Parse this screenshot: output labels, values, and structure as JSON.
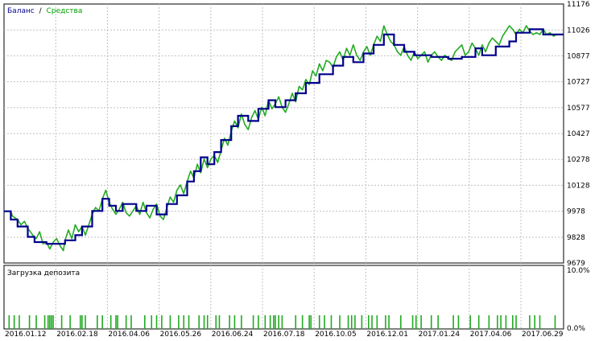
{
  "legend": {
    "balance_label": "Баланс",
    "separator": "/",
    "equity_label": "Средства",
    "balance_color": "#00008b",
    "equity_color": "#22aa22"
  },
  "deposit_panel": {
    "label": "Загрузка депозита",
    "y_ticks": [
      "10.0%",
      "0.0%"
    ],
    "bar_color": "#22aa22"
  },
  "chart_data": {
    "type": "line",
    "x_ticks": [
      "2016.01.12",
      "2016.02.18",
      "2016.04.06",
      "2016.05.26",
      "2016.06.24",
      "2016.07.18",
      "2016.10.05",
      "2016.12.01",
      "2017.01.24",
      "2017.04.06",
      "2017.06.29"
    ],
    "y_ticks": [
      11176,
      11026,
      10877,
      10727,
      10577,
      10427,
      10278,
      10128,
      9978,
      9828,
      9679
    ],
    "ylim": [
      9679,
      11176
    ],
    "xlim": [
      0,
      330
    ],
    "series": [
      {
        "name": "Баланс",
        "x": [
          0,
          4,
          4,
          8,
          8,
          14,
          14,
          18,
          18,
          25,
          25,
          36,
          36,
          42,
          42,
          46,
          46,
          52,
          52,
          58,
          58,
          62,
          62,
          66,
          66,
          70,
          70,
          78,
          78,
          84,
          84,
          90,
          90,
          96,
          96,
          102,
          102,
          108,
          108,
          112,
          112,
          116,
          116,
          120,
          120,
          124,
          124,
          128,
          128,
          134,
          134,
          138,
          138,
          144,
          144,
          150,
          150,
          156,
          156,
          160,
          160,
          166,
          166,
          172,
          172,
          178,
          178,
          186,
          186,
          194,
          194,
          200,
          200,
          206,
          206,
          212,
          212,
          218,
          218,
          224,
          224,
          230,
          230,
          236,
          236,
          242,
          242,
          252,
          252,
          262,
          262,
          270,
          270,
          278,
          278,
          282,
          282,
          290,
          290,
          298,
          298,
          302,
          302,
          310,
          310,
          318,
          318,
          322,
          322,
          330
        ],
        "y": [
          9978,
          9978,
          9930,
          9930,
          9890,
          9890,
          9830,
          9830,
          9800,
          9800,
          9790,
          9790,
          9810,
          9810,
          9840,
          9840,
          9890,
          9890,
          9980,
          9980,
          10050,
          10050,
          10010,
          10010,
          9980,
          9980,
          10020,
          10020,
          9980,
          9980,
          10010,
          10010,
          9960,
          9960,
          10020,
          10020,
          10070,
          10070,
          10150,
          10150,
          10210,
          10210,
          10290,
          10290,
          10250,
          10250,
          10320,
          10320,
          10390,
          10390,
          10470,
          10470,
          10530,
          10530,
          10500,
          10500,
          10570,
          10570,
          10620,
          10620,
          10580,
          10580,
          10620,
          10620,
          10660,
          10660,
          10720,
          10720,
          10770,
          10770,
          10820,
          10820,
          10870,
          10870,
          10840,
          10840,
          10890,
          10890,
          10940,
          10940,
          11000,
          11000,
          10940,
          10940,
          10900,
          10900,
          10880,
          10880,
          10870,
          10870,
          10860,
          10860,
          10870,
          10870,
          10920,
          10920,
          10880,
          10880,
          10930,
          10930,
          10960,
          10960,
          11010,
          11010,
          11030,
          11030,
          11000,
          11000,
          11000,
          11000
        ]
      },
      {
        "name": "Средства",
        "x": [
          0,
          4,
          5,
          8,
          10,
          12,
          14,
          17,
          19,
          21,
          23,
          25,
          27,
          29,
          31,
          33,
          35,
          36,
          38,
          40,
          42,
          44,
          46,
          48,
          50,
          52,
          54,
          56,
          58,
          60,
          62,
          64,
          66,
          68,
          70,
          72,
          74,
          76,
          78,
          80,
          82,
          84,
          86,
          88,
          90,
          92,
          94,
          96,
          98,
          100,
          102,
          104,
          106,
          108,
          110,
          112,
          114,
          116,
          118,
          120,
          122,
          124,
          126,
          128,
          130,
          132,
          134,
          136,
          138,
          140,
          142,
          144,
          146,
          148,
          150,
          152,
          154,
          156,
          158,
          160,
          162,
          164,
          166,
          168,
          170,
          172,
          174,
          176,
          178,
          180,
          182,
          184,
          186,
          188,
          190,
          192,
          194,
          196,
          198,
          200,
          202,
          204,
          206,
          208,
          210,
          212,
          214,
          216,
          218,
          220,
          222,
          224,
          226,
          228,
          230,
          232,
          234,
          236,
          238,
          240,
          242,
          244,
          246,
          248,
          250,
          252,
          254,
          256,
          258,
          260,
          262,
          264,
          266,
          268,
          270,
          272,
          274,
          276,
          278,
          280,
          282,
          284,
          286,
          288,
          290,
          292,
          294,
          296,
          298,
          300,
          302,
          304,
          306,
          308,
          310,
          312,
          314,
          316,
          318,
          320,
          322,
          324,
          326,
          328,
          330
        ],
        "y": [
          9978,
          9978,
          9950,
          9930,
          9900,
          9920,
          9880,
          9840,
          9820,
          9860,
          9790,
          9800,
          9760,
          9800,
          9820,
          9780,
          9750,
          9810,
          9870,
          9820,
          9900,
          9860,
          9890,
          9840,
          9900,
          9960,
          10000,
          9980,
          10050,
          10100,
          10030,
          9990,
          9960,
          9990,
          10030,
          9970,
          9950,
          9980,
          10010,
          9960,
          10030,
          9970,
          9940,
          9990,
          10020,
          9950,
          9930,
          10000,
          10060,
          10030,
          10100,
          10130,
          10080,
          10150,
          10210,
          10170,
          10250,
          10200,
          10280,
          10230,
          10280,
          10300,
          10260,
          10330,
          10400,
          10360,
          10440,
          10500,
          10460,
          10540,
          10480,
          10450,
          10520,
          10560,
          10510,
          10580,
          10530,
          10620,
          10570,
          10600,
          10640,
          10580,
          10550,
          10600,
          10660,
          10610,
          10700,
          10680,
          10740,
          10710,
          10790,
          10760,
          10830,
          10790,
          10850,
          10840,
          10810,
          10870,
          10900,
          10850,
          10920,
          10880,
          10940,
          10880,
          10850,
          10900,
          10930,
          10880,
          10940,
          10990,
          10960,
          11050,
          11000,
          10960,
          10940,
          10900,
          10880,
          10930,
          10880,
          10850,
          10900,
          10860,
          10880,
          10900,
          10840,
          10880,
          10900,
          10870,
          10850,
          10880,
          10860,
          10850,
          10900,
          10920,
          10940,
          10880,
          10900,
          10950,
          10920,
          10880,
          10940,
          10900,
          10950,
          10980,
          10960,
          10940,
          10990,
          11020,
          11050,
          11030,
          11000,
          11030,
          11010,
          11050,
          11020,
          11000,
          11010,
          11000,
          11030,
          11000,
          11010,
          10990,
          11000,
          11000,
          11000
        ]
      }
    ],
    "deposit_load_events": [
      3,
      6,
      9,
      15,
      19,
      24,
      26,
      27,
      28,
      29,
      34,
      39,
      45,
      46,
      48,
      55,
      58,
      63,
      66,
      67,
      72,
      75,
      83,
      87,
      90,
      93,
      98,
      103,
      106,
      109,
      115,
      118,
      120,
      125,
      127,
      133,
      136,
      140,
      147,
      150,
      154,
      157,
      159,
      160,
      162,
      164,
      172,
      176,
      180,
      181,
      186,
      189,
      193,
      198,
      203,
      205,
      207,
      211,
      215,
      217,
      220,
      225,
      227,
      234,
      241,
      243,
      246,
      252,
      256,
      265,
      268,
      275,
      280,
      286,
      291,
      293,
      296,
      300,
      302,
      310,
      313,
      316,
      325
    ]
  }
}
